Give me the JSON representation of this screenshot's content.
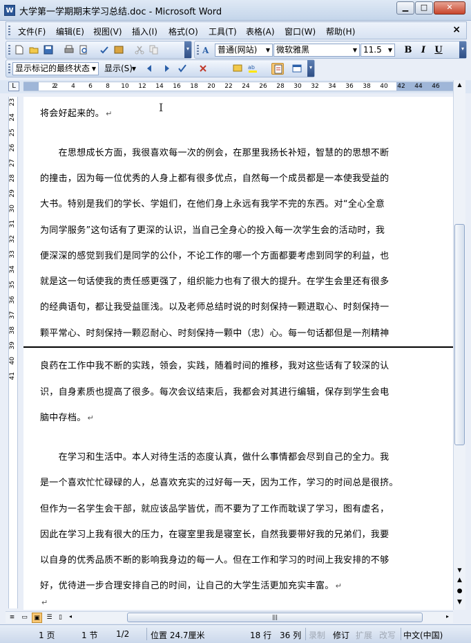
{
  "window": {
    "icon_text": "W",
    "title": "大学第一学期期末学习总结.doc - Microsoft Word",
    "min_glyph": "▁",
    "max_glyph": "□",
    "close_glyph": "✕"
  },
  "menubar": {
    "items": [
      "文件(F)",
      "编辑(E)",
      "视图(V)",
      "插入(I)",
      "格式(O)",
      "工具(T)",
      "表格(A)",
      "窗口(W)",
      "帮助(H)"
    ],
    "close_glyph": "×"
  },
  "toolbar_formatting": {
    "style_value": "普通(网站)",
    "font_value": "微软雅黑",
    "size_value": "11.5",
    "bold_label": "B",
    "italic_label": "I",
    "underline_label": "U"
  },
  "toolbar_reviewing": {
    "display_value": "显示标记的最终状态",
    "show_label": "显示(S)"
  },
  "ruler": {
    "corner_glyph": "L",
    "ticks": [
      "2",
      "2",
      "4",
      "6",
      "8",
      "10",
      "12",
      "14",
      "16",
      "18",
      "20",
      "22",
      "24",
      "26",
      "28",
      "30",
      "32",
      "34",
      "36",
      "38",
      "40",
      "42",
      "44",
      "46"
    ],
    "vticks": [
      "23",
      "24",
      "25",
      "26",
      "27",
      "28",
      "29",
      "30",
      "31",
      "32",
      "33",
      "34",
      "35",
      "36",
      "37",
      "38",
      "39",
      "40",
      "41"
    ]
  },
  "document": {
    "lines": [
      "将会好起来的。",
      "",
      "　　在思想成长方面，我很喜欢每一次的例会，在那里我扬长补短，智慧的的思想不断",
      "的撞击，因为每一位优秀的人身上都有很多优点，自然每一个成员都是一本使我受益的",
      "大书。特别是我们的学长、学姐们，在他们身上永远有我学不完的东西。对“全心全意",
      "为同学服务”这句话有了更深的认识，当自己全身心的投入每一次学生会的活动时，我",
      "便深深的感觉到我们是同学的公仆，不论工作的哪一个方面都要考虑到同学的利益，也",
      "就是这一句话使我的责任感更强了，组织能力也有了很大的提升。在学生会里还有很多",
      "的经典语句，都让我受益匪浅。以及老师总结时说的时刻保持一颗进取心、时刻保持一",
      "颗平常心、时刻保持一颗忍耐心、时刻保持一颗中（忠）心。每一句话都但是一剂精神",
      "良药在工作中我不断的实践，领会，实践，随着时间的推移，我对这些话有了较深的认",
      "识，自身素质也提高了很多。每次会议结束后，我都会对其进行编辑，保存到学生会电",
      "脑中存档。",
      "",
      "　　在学习和生活中。本人对待生活的态度认真，做什么事情都会尽到自己的全力。我",
      "是一个喜欢忙忙碌碌的人，总喜欢充实的过好每一天，因为工作，学习的时间总是很挤。",
      "但作为一名学生会干部，就应该品学皆优，而不要为了工作而耽误了学习，图有虚名，",
      "因此在学习上我有很大的压力，在寝室里我是寝室长，自然我要带好我的兄弟们，我要",
      "以自身的优秀品质不断的影响我身边的每一人。但在工作和学习的时间上我安排的不够",
      "好，优待进一步合理安排自己的时间，让自己的大学生活更加充实丰富。",
      ""
    ],
    "paragraph_mark": "↵",
    "cursor_glyph": "I"
  },
  "scrollbar": {
    "up_glyph": "▲",
    "down_glyph": "▼",
    "prev_glyph": "▲",
    "select_glyph": "●",
    "next_glyph": "▼",
    "left_glyph": "◂",
    "right_glyph": "▸",
    "thumb_grip": "|||"
  },
  "statusbar": {
    "page": "1 页",
    "section": "1 节",
    "page_of": "1/2",
    "position": "位置 24.7厘米",
    "line": "18 行",
    "column": "36 列",
    "rec": "录制",
    "trk": "修订",
    "ext": "扩展",
    "ovr": "改写",
    "language": "中文(中国)"
  }
}
